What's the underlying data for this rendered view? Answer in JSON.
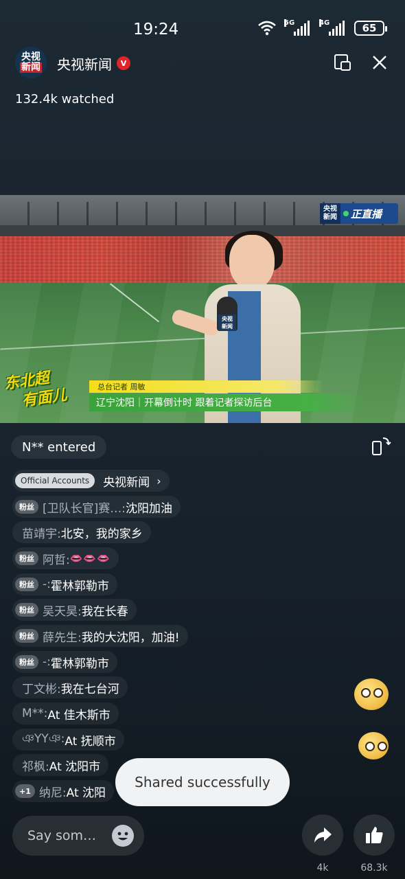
{
  "status": {
    "time": "19:24",
    "net1": "5G",
    "net2": "4G",
    "battery": "65"
  },
  "header": {
    "logo_line1": "央视",
    "logo_line2": "新闻",
    "channel_name": "央视新闻",
    "verified": "V",
    "watched": "132.4k watched"
  },
  "video": {
    "live_logo_line1": "央视",
    "live_logo_line2": "新闻",
    "live_text": "正直播",
    "mic_line1": "央视",
    "mic_line2": "新闻",
    "show_title_line1": "东北超",
    "show_title_line2": "有面儿",
    "reporter_label": "总台记者 周敏",
    "headline": "辽宁沈阳｜开幕倒计时 跟着记者探访后台"
  },
  "chat": {
    "entered": "N** entered",
    "official_badge": "Official Accounts",
    "official_name": "央视新闻",
    "fan_label": "粉丝",
    "plus_badge": "+1",
    "messages": [
      {
        "user": "[卫队长官]赛…:",
        "text": " 沈阳加油"
      },
      {
        "user": "苗靖宇:",
        "text": " 北安，我的家乡"
      },
      {
        "user": "阿哲:",
        "text": " 👄👄👄"
      },
      {
        "user": "-:",
        "text": " 霍林郭勒市"
      },
      {
        "user": "吴天昊:",
        "text": " 我在长春"
      },
      {
        "user": "薛先生:",
        "text": " 我的大沈阳，加油!"
      },
      {
        "user": "-:",
        "text": " 霍林郭勒市"
      },
      {
        "user": "丁文彬:",
        "text": " 我在七台河"
      },
      {
        "user": "M**:",
        "text": " At 佳木斯市"
      },
      {
        "user": "ঞYYঞ:",
        "text": " At 抚顺市"
      },
      {
        "user": "祁枫:",
        "text": " At 沈阳市"
      },
      {
        "user": "纳尼:",
        "text": " At 沈阳"
      }
    ]
  },
  "toast": "Shared successfully",
  "bottom": {
    "input_placeholder": "Say som…",
    "share_count": "4k",
    "like_count": "68.3k"
  }
}
